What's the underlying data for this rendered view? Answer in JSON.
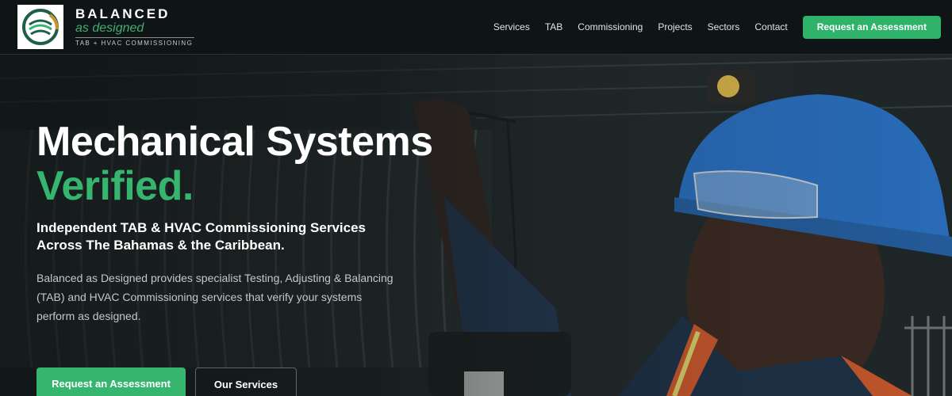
{
  "header": {
    "logo_icon": "balanced-logo-mark",
    "brand_name": "BALANCED",
    "brand_tagline": "as designed",
    "brand_subtitle": "TAB + HVAC COMMISSIONING",
    "nav": [
      "Services",
      "TAB",
      "Commissioning",
      "Projects",
      "Sectors",
      "Contact"
    ],
    "cta_label": "Request an Assessment"
  },
  "hero": {
    "headline": "Mechanical Systems",
    "headline_accent": "Verified.",
    "subheadline": "Independent TAB & HVAC Commissioning Services Across The Bahamas & the Caribbean.",
    "description": "Balanced as Designed provides specialist Testing, Adjusting & Balancing (TAB) and HVAC Commissioning services that verify your systems perform as designed.",
    "primary_button": "Request an Assessment",
    "secondary_button": "Our Services"
  },
  "colors": {
    "accent": "#36b56e",
    "header_bg": "#0f1516",
    "hard_hat": "#2a6fc0"
  }
}
